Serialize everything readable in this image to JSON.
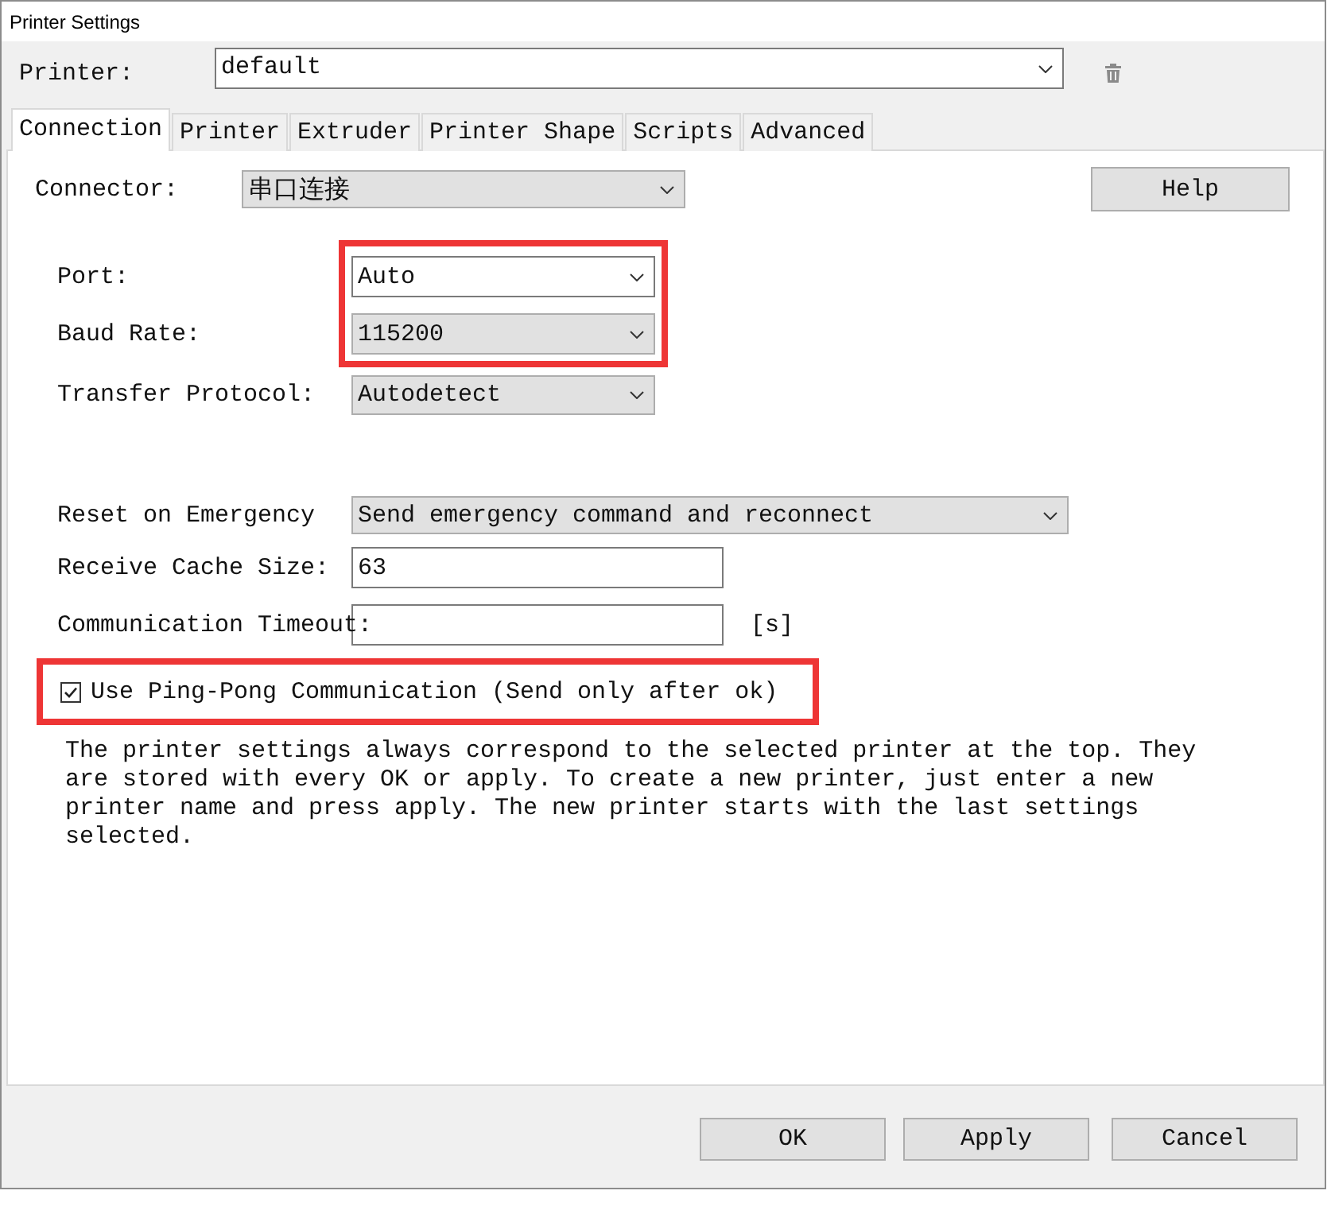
{
  "window": {
    "title": "Printer Settings"
  },
  "printer": {
    "label": "Printer:",
    "value": "default"
  },
  "tabs": [
    {
      "label": "Connection",
      "selected": true
    },
    {
      "label": "Printer",
      "selected": false
    },
    {
      "label": "Extruder",
      "selected": false
    },
    {
      "label": "Printer Shape",
      "selected": false
    },
    {
      "label": "Scripts",
      "selected": false
    },
    {
      "label": "Advanced",
      "selected": false
    }
  ],
  "connector": {
    "label": "Connector:",
    "value": "串口连接"
  },
  "help_button": {
    "label": "Help"
  },
  "port_group": {
    "highlighted": true,
    "rows": [
      {
        "label": "Port:",
        "value": "Auto",
        "kind": "editable"
      },
      {
        "label": "Baud Rate:",
        "value": "115200",
        "kind": "list"
      }
    ]
  },
  "transfer_protocol": {
    "label": "Transfer Protocol:",
    "value": "Autodetect"
  },
  "reset_on_emergency": {
    "label": "Reset on Emergency",
    "value": "Send emergency command and reconnect"
  },
  "receive_cache_size": {
    "label": "Receive Cache Size:",
    "value": "63"
  },
  "communication_timeout": {
    "label": "Communication Timeout:",
    "unit": "[s]"
  },
  "ping_pong": {
    "label": "Use Ping-Pong Communication (Send only after ok)",
    "checked": true,
    "highlighted": true
  },
  "note": "The printer settings always correspond to the selected printer at the top. They are stored with every OK or apply. To create a new printer, just enter a new printer name and press apply. The new printer starts with the last settings selected.",
  "buttons": [
    {
      "label": "OK"
    },
    {
      "label": "Apply"
    },
    {
      "label": "Cancel"
    }
  ]
}
